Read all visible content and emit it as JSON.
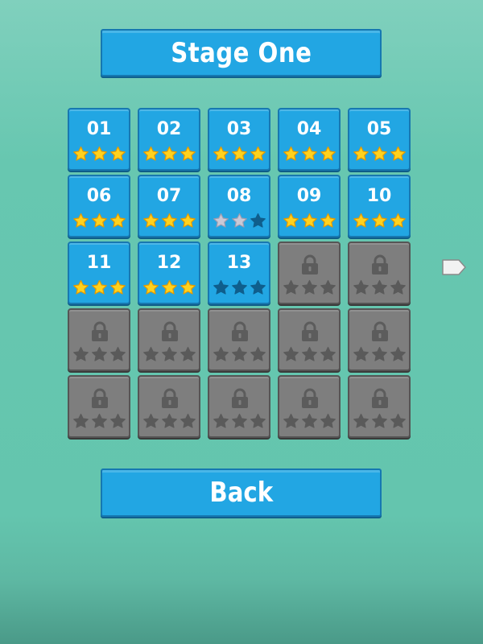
{
  "header": {
    "title": "Stage One"
  },
  "levels": [
    {
      "label": "01",
      "locked": false,
      "stars": 3
    },
    {
      "label": "02",
      "locked": false,
      "stars": 3
    },
    {
      "label": "03",
      "locked": false,
      "stars": 3
    },
    {
      "label": "04",
      "locked": false,
      "stars": 3
    },
    {
      "label": "05",
      "locked": false,
      "stars": 3
    },
    {
      "label": "06",
      "locked": false,
      "stars": 3
    },
    {
      "label": "07",
      "locked": false,
      "stars": 3
    },
    {
      "label": "08",
      "locked": false,
      "stars": 2,
      "earned_star_color": "silver"
    },
    {
      "label": "09",
      "locked": false,
      "stars": 3
    },
    {
      "label": "10",
      "locked": false,
      "stars": 3
    },
    {
      "label": "11",
      "locked": false,
      "stars": 3
    },
    {
      "label": "12",
      "locked": false,
      "stars": 3
    },
    {
      "label": "13",
      "locked": false,
      "stars": 0
    },
    {
      "label": "",
      "locked": true,
      "stars": 0
    },
    {
      "label": "",
      "locked": true,
      "stars": 0
    },
    {
      "label": "",
      "locked": true,
      "stars": 0
    },
    {
      "label": "",
      "locked": true,
      "stars": 0
    },
    {
      "label": "",
      "locked": true,
      "stars": 0
    },
    {
      "label": "",
      "locked": true,
      "stars": 0
    },
    {
      "label": "",
      "locked": true,
      "stars": 0
    },
    {
      "label": "",
      "locked": true,
      "stars": 0
    },
    {
      "label": "",
      "locked": true,
      "stars": 0
    },
    {
      "label": "",
      "locked": true,
      "stars": 0
    },
    {
      "label": "",
      "locked": true,
      "stars": 0
    },
    {
      "label": "",
      "locked": true,
      "stars": 0
    }
  ],
  "next_page_icon": "arrow-tag-icon",
  "footer": {
    "back_label": "Back"
  },
  "colors": {
    "background": "#67c7b0",
    "tile_unlocked": "#22a6e3",
    "tile_locked": "#7e7e7e",
    "star_gold": "#ffd21e",
    "star_silver": "#c9c9d6",
    "star_empty": "#0f5e8c",
    "star_locked": "#5a5a5a"
  }
}
